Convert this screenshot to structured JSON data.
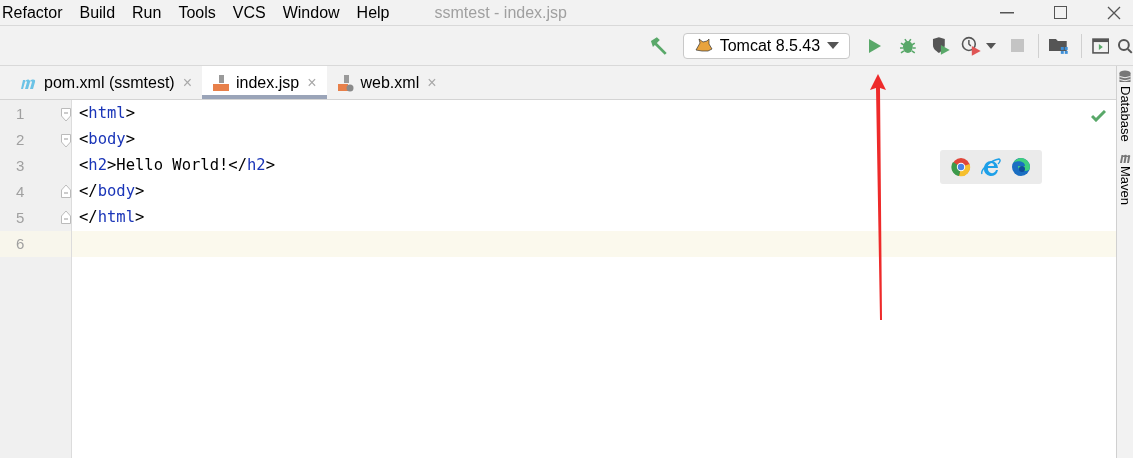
{
  "menu": [
    {
      "label": "Refactor"
    },
    {
      "label": "Build"
    },
    {
      "label": "Run"
    },
    {
      "label": "Tools"
    },
    {
      "label": "VCS"
    },
    {
      "label": "Window"
    },
    {
      "label": "Help"
    }
  ],
  "window": {
    "title": "ssmtest - index.jsp"
  },
  "run_config": {
    "label": "Tomcat 8.5.43"
  },
  "tabs": [
    {
      "label": "pom.xml (ssmtest)",
      "kind": "maven",
      "selected": false,
      "close": "×"
    },
    {
      "label": "index.jsp",
      "kind": "jsp",
      "selected": true,
      "close": "×"
    },
    {
      "label": "web.xml",
      "kind": "xml",
      "selected": false,
      "close": "×"
    }
  ],
  "code_lines": [
    {
      "number": "1",
      "kind": "open",
      "current": false,
      "tokens": [
        {
          "text": "<",
          "kind": "punct"
        },
        {
          "text": "html",
          "kind": "tag"
        },
        {
          "text": ">",
          "kind": "punct"
        }
      ]
    },
    {
      "number": "2",
      "kind": "open",
      "current": false,
      "tokens": [
        {
          "text": "<",
          "kind": "punct"
        },
        {
          "text": "body",
          "kind": "tag"
        },
        {
          "text": ">",
          "kind": "punct"
        }
      ]
    },
    {
      "number": "3",
      "kind": "plain",
      "current": false,
      "tokens": [
        {
          "text": "<",
          "kind": "punct"
        },
        {
          "text": "h2",
          "kind": "tag"
        },
        {
          "text": ">Hello World!</",
          "kind": "punct"
        },
        {
          "text": "h2",
          "kind": "tag"
        },
        {
          "text": ">",
          "kind": "punct"
        }
      ]
    },
    {
      "number": "4",
      "kind": "close",
      "current": false,
      "tokens": [
        {
          "text": "</",
          "kind": "punct"
        },
        {
          "text": "body",
          "kind": "tag"
        },
        {
          "text": ">",
          "kind": "punct"
        }
      ]
    },
    {
      "number": "5",
      "kind": "close",
      "current": false,
      "tokens": [
        {
          "text": "</",
          "kind": "punct"
        },
        {
          "text": "html",
          "kind": "tag"
        },
        {
          "text": ">",
          "kind": "punct"
        }
      ]
    },
    {
      "number": "6",
      "kind": "plain",
      "current": true
    }
  ],
  "side_panels": [
    {
      "label": "Database",
      "kind": "database"
    },
    {
      "label": "Maven",
      "kind": "maven"
    }
  ]
}
